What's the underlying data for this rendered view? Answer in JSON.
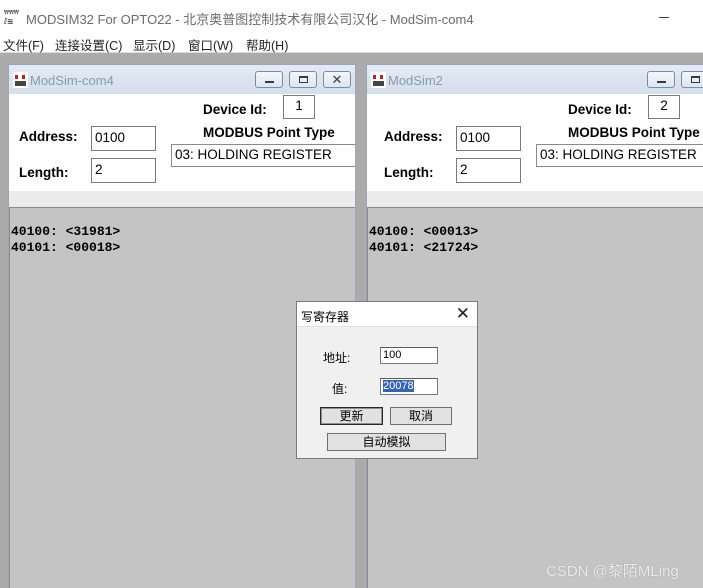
{
  "app": {
    "title": "MODSIM32 For OPTO22 - 北京奥普图控制技术有限公司汉化 - ModSim-com4",
    "icon": "modsim-app-icon"
  },
  "menu": [
    "文件(F)",
    "连接设置(C)",
    "显示(D)",
    "窗口(W)",
    "帮助(H)"
  ],
  "windows": [
    {
      "title": "ModSim-com4",
      "device_id_label": "Device Id:",
      "device_id": "1",
      "address_label": "Address:",
      "address": "0100",
      "length_label": "Length:",
      "length": "2",
      "point_type_label": "MODBUS Point Type",
      "point_type": "03: HOLDING REGISTER",
      "registers": [
        "40100: <31981>",
        "40101: <00018>"
      ]
    },
    {
      "title": "ModSim2",
      "device_id_label": "Device Id:",
      "device_id": "2",
      "address_label": "Address:",
      "address": "0100",
      "length_label": "Length:",
      "length": "2",
      "point_type_label": "MODBUS Point Type",
      "point_type": "03: HOLDING REGISTER",
      "registers": [
        "40100: <00013>",
        "40101: <21724>"
      ]
    }
  ],
  "dialog": {
    "title": "写寄存器",
    "close_glyph": "✕",
    "address_label": "地址:",
    "address_value": "100",
    "value_label": "值:",
    "value_value": "20078",
    "update_button": "更新",
    "cancel_button": "取消",
    "auto_sim_button": "自动模拟"
  },
  "watermark": "CSDN @黎陌MLing",
  "colors": {
    "workspace": "#ababab",
    "child_caption": "#d8e3ef",
    "data_area": "#c4c4c4",
    "selection": "#3464b4"
  }
}
